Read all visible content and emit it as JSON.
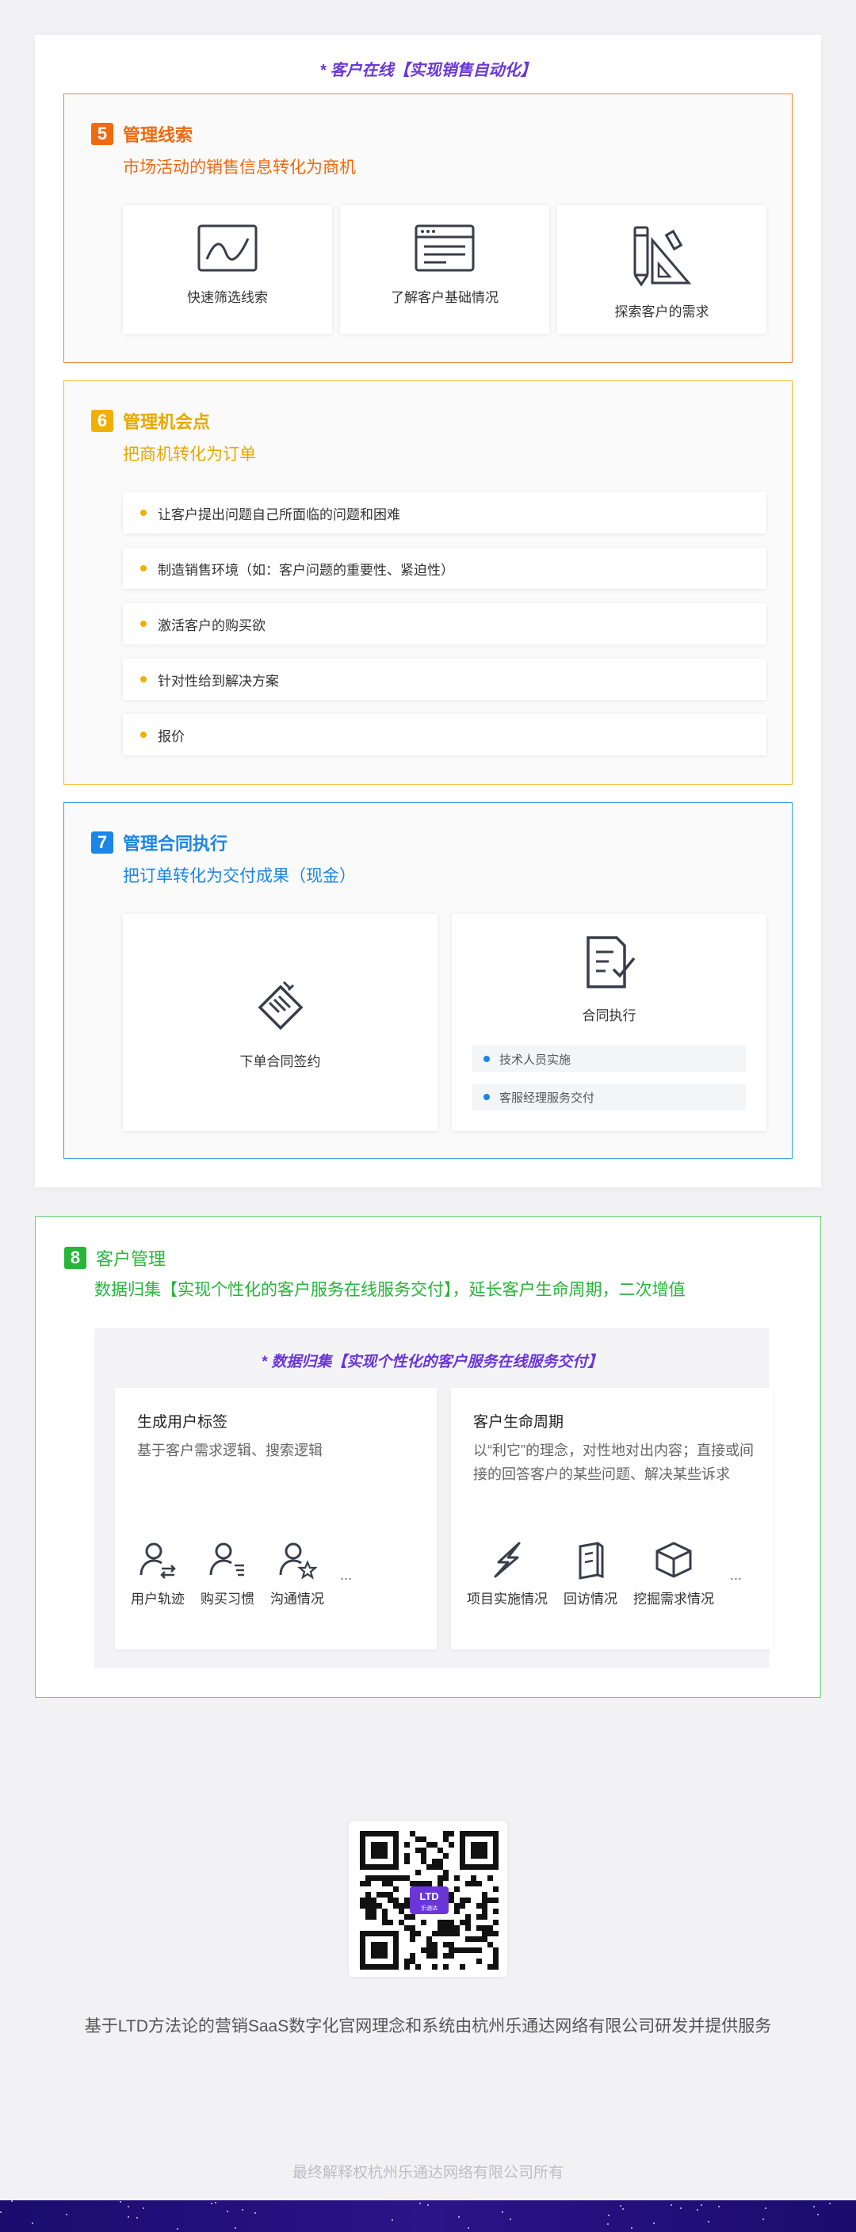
{
  "main_card": {
    "title": "* 客户在线【实现销售自动化】"
  },
  "section5": {
    "number": "5",
    "name": "管理线索",
    "subtitle": "市场活动的销售信息转化为商机",
    "tiles": [
      {
        "label": "快速筛选线索",
        "icon": "line-chart-icon"
      },
      {
        "label": "了解客户基础情况",
        "icon": "browser-window-icon"
      },
      {
        "label": "探索客户的需求",
        "icon": "pencil-ruler-icon"
      }
    ]
  },
  "section6": {
    "number": "6",
    "name": "管理机会点",
    "subtitle": "把商机转化为订单",
    "items": [
      "让客户提出问题自己所面临的问题和困难",
      "制造销售环境（如：客户问题的重要性、紧迫性）",
      "激活客户的购买欲",
      "针对性给到解决方案",
      "报价"
    ]
  },
  "section7": {
    "number": "7",
    "name": "管理合同执行",
    "subtitle": "把订单转化为交付成果（现金）",
    "sign": {
      "label": "下单合同签约",
      "icon": "handshake-icon"
    },
    "execute": {
      "label": "合同执行",
      "icon": "document-check-icon",
      "chips": [
        "技术人员实施",
        "客服经理服务交付"
      ]
    }
  },
  "section8": {
    "number": "8",
    "name": "客户管理",
    "subtitle": "数据归集【实现个性化的客户服务在线服务交付】，延长客户生命周期，二次增值",
    "inner_title": "* 数据归集【实现个性化的客户服务在线服务交付】",
    "left_panel": {
      "title": "生成用户标签",
      "desc": "基于客户需求逻辑、搜索逻辑",
      "icons": [
        {
          "label": "用户轨迹",
          "icon": "user-track-icon"
        },
        {
          "label": "购买习惯",
          "icon": "user-list-icon"
        },
        {
          "label": "沟通情况",
          "icon": "user-star-icon"
        }
      ],
      "more": "..."
    },
    "right_panel": {
      "title": "客户生命周期",
      "desc": "以“利它”的理念，对性地对出内容；直接或间接的回答客户的某些问题、解决某些诉求",
      "icons": [
        {
          "label": "项目实施情况",
          "icon": "lightning-icon"
        },
        {
          "label": "回访情况",
          "icon": "book-icon"
        },
        {
          "label": "挖掘需求情况",
          "icon": "box-icon"
        }
      ],
      "more": "..."
    }
  },
  "qr": {
    "logo_text": "LTD",
    "logo_sub": "乐通达"
  },
  "footer": {
    "text": "基于LTD方法论的营销SaaS数字化官网理念和系统由杭州乐通达网络有限公司研发并提供服务",
    "copyright": "最终解释权杭州乐通达网络有限公司所有"
  },
  "colors": {
    "section5": "#f06a10",
    "section6": "#f0b000",
    "section7": "#1a86e8",
    "section8": "#27b53a",
    "accent_purple": "#6a36d9"
  }
}
